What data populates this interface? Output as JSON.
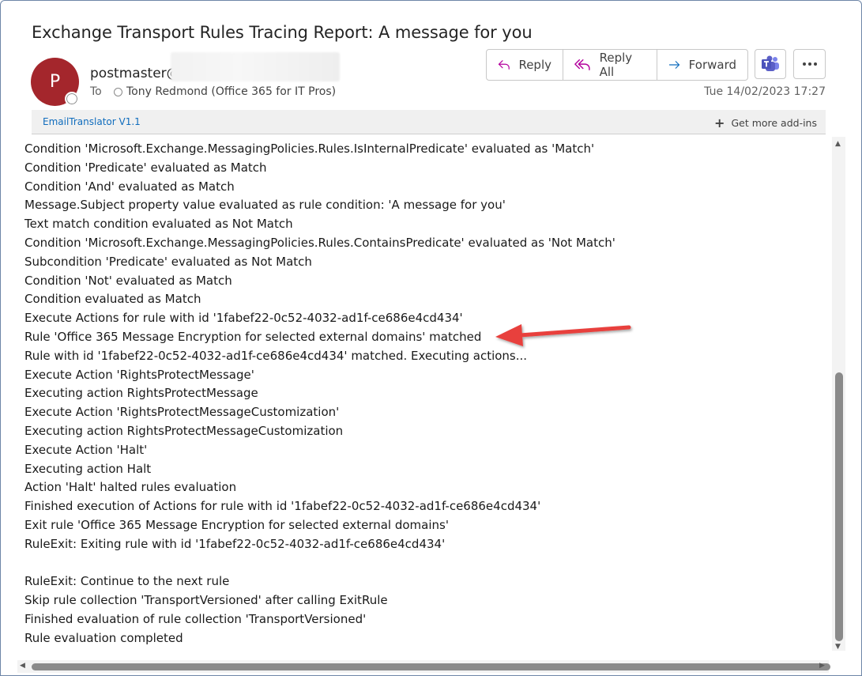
{
  "message": {
    "subject": "Exchange Transport Rules Tracing Report: A message for you",
    "sender_initial": "P",
    "sender": "postmaster@",
    "to_label": "To",
    "recipient": "Tony Redmond (Office 365 for IT Pros)",
    "date": "Tue 14/02/2023 17:27"
  },
  "actions": {
    "reply": "Reply",
    "reply_all": "Reply All",
    "forward": "Forward"
  },
  "addin_bar": {
    "addin_name": "EmailTranslator V1.1",
    "get_more": "Get more add-ins"
  },
  "body_lines": [
    "Condition 'Microsoft.Exchange.MessagingPolicies.Rules.IsInternalPredicate' evaluated as 'Match'",
    "Condition 'Predicate' evaluated as Match",
    "Condition 'And' evaluated as Match",
    "Message.Subject property value evaluated as rule condition: 'A message for you'",
    "Text match condition evaluated as Not Match",
    "Condition 'Microsoft.Exchange.MessagingPolicies.Rules.ContainsPredicate' evaluated as 'Not Match'",
    "Subcondition 'Predicate' evaluated as Not Match",
    "Condition 'Not' evaluated as Match",
    "Condition evaluated as Match",
    "Execute Actions for rule with id '1fabef22-0c52-4032-ad1f-ce686e4cd434'",
    "Rule 'Office 365 Message Encryption for selected external domains' matched",
    "Rule with id '1fabef22-0c52-4032-ad1f-ce686e4cd434' matched. Executing actions...",
    "Execute Action 'RightsProtectMessage'",
    "Executing action RightsProtectMessage",
    "Execute Action 'RightsProtectMessageCustomization'",
    "Executing action RightsProtectMessageCustomization",
    "Execute Action 'Halt'",
    "Executing action Halt",
    "Action 'Halt' halted rules evaluation",
    "Finished execution of Actions for rule with id '1fabef22-0c52-4032-ad1f-ce686e4cd434'",
    "Exit rule 'Office 365 Message Encryption for selected external domains'",
    "RuleExit: Exiting rule with id '1fabef22-0c52-4032-ad1f-ce686e4cd434'",
    "",
    "RuleExit: Continue to the next rule",
    "Skip rule collection 'TransportVersioned' after calling ExitRule",
    "Finished evaluation of rule collection 'TransportVersioned'",
    "Rule evaluation completed"
  ],
  "icons": {
    "reply": "reply-icon",
    "reply_all": "reply-all-icon",
    "forward": "forward-icon",
    "teams": "teams-icon",
    "more": "more-options-icon",
    "add": "plus-icon",
    "annotation": "red-arrow-annotation"
  },
  "colors": {
    "avatar": "#a4262c",
    "reply_icon": "#b4009e",
    "forward_icon": "#0f6cbd",
    "teams": "#5b5fc7",
    "link": "#0f6cbd",
    "annotation_arrow": "#e8413c"
  }
}
